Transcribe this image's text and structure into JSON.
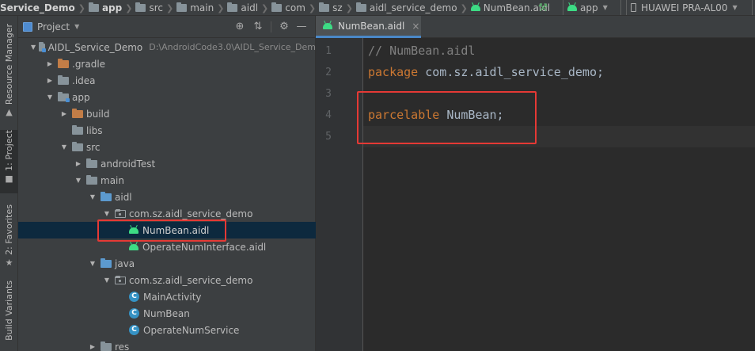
{
  "navbar": {
    "crumbs": [
      {
        "label": "Service_Demo",
        "icon": "",
        "bold": true
      },
      {
        "label": "app",
        "icon": "folder",
        "bold": true
      },
      {
        "label": "src",
        "icon": "folder",
        "bold": false
      },
      {
        "label": "main",
        "icon": "folder",
        "bold": false
      },
      {
        "label": "aidl",
        "icon": "folder",
        "bold": false
      },
      {
        "label": "com",
        "icon": "folder",
        "bold": false
      },
      {
        "label": "sz",
        "icon": "folder",
        "bold": false
      },
      {
        "label": "aidl_service_demo",
        "icon": "folder",
        "bold": false
      },
      {
        "label": "NumBean.aidl",
        "icon": "android",
        "bold": false
      }
    ],
    "run_config": "app",
    "device": "HUAWEI PRA-AL00"
  },
  "tool_strip": {
    "resource_manager": "Resource Manager",
    "project": "1: Project",
    "favorites": "2: Favorites",
    "build_variants": "Build Variants"
  },
  "project_panel": {
    "title": "Project",
    "tree": [
      {
        "label": "AIDL_Service_Demo",
        "path": "D:\\AndroidCode3.0\\AIDL_Service_Dem",
        "indent": 0,
        "toggle": "open",
        "icon": "module",
        "selected": false
      },
      {
        "label": ".gradle",
        "indent": 1,
        "toggle": "closed",
        "icon": "folder-orange",
        "selected": false
      },
      {
        "label": ".idea",
        "indent": 1,
        "toggle": "closed",
        "icon": "folder-grey",
        "selected": false
      },
      {
        "label": "app",
        "indent": 1,
        "toggle": "open",
        "icon": "module",
        "selected": false
      },
      {
        "label": "build",
        "indent": 2,
        "toggle": "closed",
        "icon": "folder-orange",
        "selected": false
      },
      {
        "label": "libs",
        "indent": 2,
        "toggle": "none",
        "icon": "folder-grey",
        "selected": false
      },
      {
        "label": "src",
        "indent": 2,
        "toggle": "open",
        "icon": "folder-grey",
        "selected": false
      },
      {
        "label": "androidTest",
        "indent": 3,
        "toggle": "closed",
        "icon": "folder-grey",
        "selected": false
      },
      {
        "label": "main",
        "indent": 3,
        "toggle": "open",
        "icon": "folder-grey",
        "selected": false
      },
      {
        "label": "aidl",
        "indent": 4,
        "toggle": "open",
        "icon": "folder-blue",
        "selected": false
      },
      {
        "label": "com.sz.aidl_service_demo",
        "indent": 5,
        "toggle": "open",
        "icon": "package",
        "selected": false
      },
      {
        "label": "NumBean.aidl",
        "indent": 6,
        "toggle": "none",
        "icon": "android",
        "selected": true
      },
      {
        "label": "OperateNumInterface.aidl",
        "indent": 6,
        "toggle": "none",
        "icon": "android",
        "selected": false
      },
      {
        "label": "java",
        "indent": 4,
        "toggle": "open",
        "icon": "folder-blue",
        "selected": false
      },
      {
        "label": "com.sz.aidl_service_demo",
        "indent": 5,
        "toggle": "open",
        "icon": "package",
        "selected": false
      },
      {
        "label": "MainActivity",
        "indent": 6,
        "toggle": "none",
        "icon": "class",
        "selected": false
      },
      {
        "label": "NumBean",
        "indent": 6,
        "toggle": "none",
        "icon": "class",
        "selected": false
      },
      {
        "label": "OperateNumService",
        "indent": 6,
        "toggle": "none",
        "icon": "class",
        "selected": false
      },
      {
        "label": "res",
        "indent": 4,
        "toggle": "closed",
        "icon": "folder-grey",
        "selected": false
      }
    ]
  },
  "editor": {
    "tab_label": "NumBean.aidl",
    "lines": [
      {
        "num": "1",
        "tokens": [
          {
            "t": "// NumBean.aidl",
            "k": "comment"
          }
        ]
      },
      {
        "num": "2",
        "tokens": [
          {
            "t": "package",
            "k": "kw"
          },
          {
            "t": " com.sz.aidl_service_demo;",
            "k": "txt"
          }
        ]
      },
      {
        "num": "3",
        "tokens": []
      },
      {
        "num": "4",
        "tokens": [
          {
            "t": "parcelable",
            "k": "kw"
          },
          {
            "t": " NumBean;",
            "k": "txt"
          }
        ]
      },
      {
        "num": "5",
        "tokens": []
      }
    ],
    "current_line": 5
  },
  "colors": {
    "highlight_box": "#e53935",
    "selection": "#0d293e",
    "keyword": "#cc7832",
    "comment": "#808080"
  }
}
